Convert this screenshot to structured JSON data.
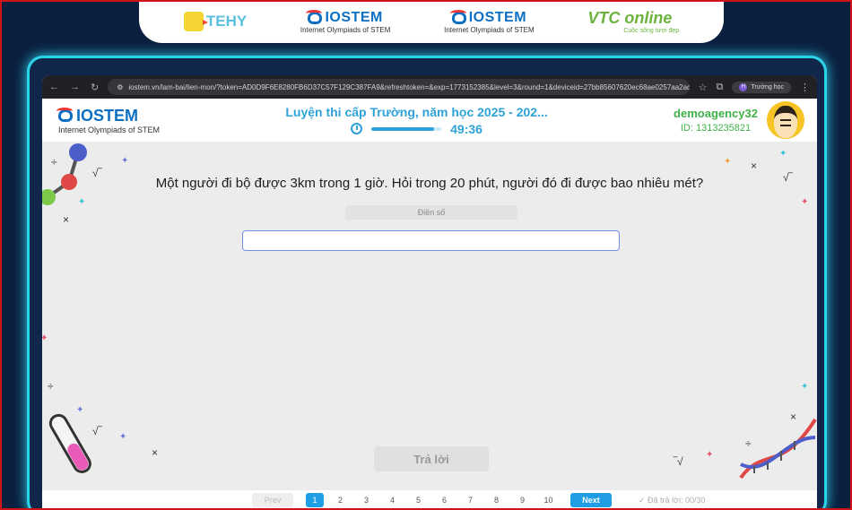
{
  "strip_logos": {
    "tehy": "TEHY",
    "iostem_1": {
      "name": "IOSTEM",
      "tagline": "Internet Olympiads of STEM"
    },
    "iostem_2": {
      "name": "IOSTEM",
      "tagline": "Internet Olympiads of STEM"
    },
    "vtc": {
      "name": "VTC online",
      "tagline": "Cuộc sống tươi đẹp"
    }
  },
  "browser": {
    "url": "iostem.vn/lam-bai/lien-mon/?token=AD0D9F6E8280FB6D37C57F129C387FA9&refreshtoken=&exp=1773152385&level=3&round=1&deviceid=27bb85607620ec68ae0257aa2acec...",
    "profile_label": "Trường học",
    "profile_initial": "H"
  },
  "header": {
    "logo_name": "IOSTEM",
    "logo_tagline": "Internet Olympiads of STEM",
    "contest_title": "Luyện thi cấp Trường, năm học 2025 - 202...",
    "timer": "49:36",
    "time_progress": 0.9,
    "username": "demoagency32",
    "user_id": "ID: 1313235821"
  },
  "question": {
    "text": "Một người đi bộ được 3km trong 1 giờ. Hỏi trong 20 phút, người đó đi được bao nhiêu mét?",
    "answer_hint": "Điền số",
    "answer_value": ""
  },
  "submit_label": "Trả lời",
  "pagination": {
    "prev_label": "Prev",
    "pages": [
      "1",
      "2",
      "3",
      "4",
      "5",
      "6",
      "7",
      "8",
      "9",
      "10"
    ],
    "current": "1",
    "next_label": "Next",
    "answered": "Đã trả lời: 00/30"
  },
  "colors": {
    "accent": "#2ea3d8",
    "user_green": "#3fb24a",
    "page_blue": "#1f9ee6",
    "frame_cyan": "#2bd4e8"
  }
}
